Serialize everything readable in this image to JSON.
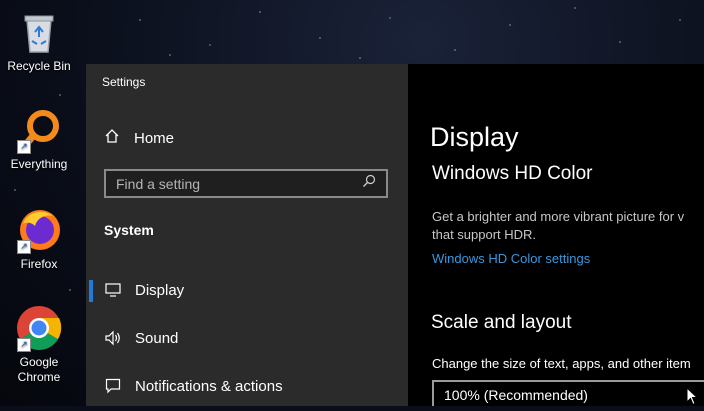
{
  "desktop": {
    "icons": [
      {
        "label": "Recycle Bin"
      },
      {
        "label": "Everything"
      },
      {
        "label": "Firefox"
      },
      {
        "label_line1": "Google",
        "label_line2": "Chrome"
      }
    ]
  },
  "window": {
    "title": "Settings"
  },
  "sidebar": {
    "home_label": "Home",
    "search_placeholder": "Find a setting",
    "section": "System",
    "items": [
      {
        "label": "Display",
        "icon": "monitor-icon",
        "selected": true
      },
      {
        "label": "Sound",
        "icon": "speaker-icon"
      },
      {
        "label": "Notifications & actions",
        "icon": "notification-icon"
      }
    ]
  },
  "content": {
    "page_title": "Display",
    "hdr": {
      "heading": "Windows HD Color",
      "description_line1": "Get a brighter and more vibrant picture for v",
      "description_line2": "that support HDR.",
      "link": "Windows HD Color settings"
    },
    "scale": {
      "heading": "Scale and layout",
      "description": "Change the size of text, apps, and other item",
      "dropdown_value": "100% (Recommended)"
    }
  },
  "colors": {
    "accent": "#1f7ad8",
    "link": "#3a96dd",
    "sidebar_bg": "#2b2b2b",
    "content_bg": "#000000"
  }
}
